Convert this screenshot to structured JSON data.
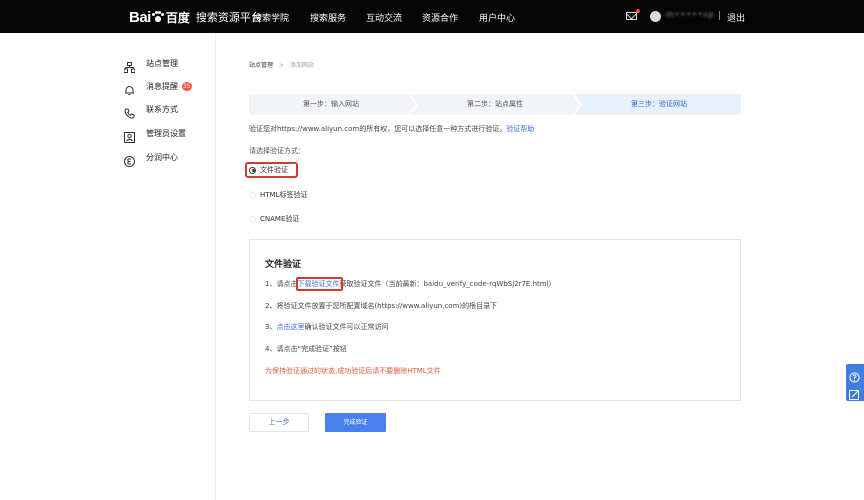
{
  "header": {
    "logo_text_en": "Bai",
    "logo_text_cn": "百度",
    "product": "搜索资源平台",
    "nav": [
      "搜索学院",
      "搜索服务",
      "互动交流",
      "资源合作",
      "用户中心"
    ],
    "username": "m•••••sp",
    "separator": "|",
    "logout": "退出"
  },
  "sidebar": {
    "items": [
      {
        "label": "站点管理",
        "icon": "sitemap-icon"
      },
      {
        "label": "消息提醒",
        "icon": "bell-icon",
        "badge": "35"
      },
      {
        "label": "联系方式",
        "icon": "phone-icon"
      },
      {
        "label": "管理员设置",
        "icon": "admin-icon"
      },
      {
        "label": "分润中心",
        "icon": "coin-icon"
      }
    ]
  },
  "breadcrumb": {
    "root": "站点管理",
    "arrow": ">",
    "current": "添加网站"
  },
  "steps": [
    {
      "label": "第一步：输入网站",
      "active": false
    },
    {
      "label": "第二步：站点属性",
      "active": false
    },
    {
      "label": "第三步：验证网站",
      "active": true
    }
  ],
  "description": {
    "text": "验证您对https://www.aliyun.com的所有权，您可以选择任意一种方式进行验证。",
    "link": "验证帮助"
  },
  "choose_label": "请选择验证方式：",
  "methods": [
    {
      "label": "文件验证",
      "checked": true
    },
    {
      "label": "HTML标签验证",
      "checked": false
    },
    {
      "label": "CNAME验证",
      "checked": false
    }
  ],
  "panel": {
    "title": "文件验证",
    "line1_prefix": "1、请点击",
    "line1_link": "下载验证文件",
    "line1_suffix": "获取验证文件（当前最新：baidu_verify_code-rqWbSj2r7E.html）",
    "line2": "2、将验证文件放置于您所配置域名(https://www.aliyun.com)的根目录下",
    "line3_prefix": "3、",
    "line3_link": "点击这里",
    "line3_suffix": "确认验证文件可以正常访问",
    "line4": "4、请点击“完成验证”按钮",
    "warning": "为保持验证通过的状态,成功验证后请不要删除HTML文件"
  },
  "buttons": {
    "prev": "上一步",
    "done": "完成验证"
  },
  "colors": {
    "accent": "#4a80ec",
    "link": "#3a6fd8",
    "warn": "#e4573d",
    "highlight": "#d23b2f",
    "topbar": "#050505"
  }
}
